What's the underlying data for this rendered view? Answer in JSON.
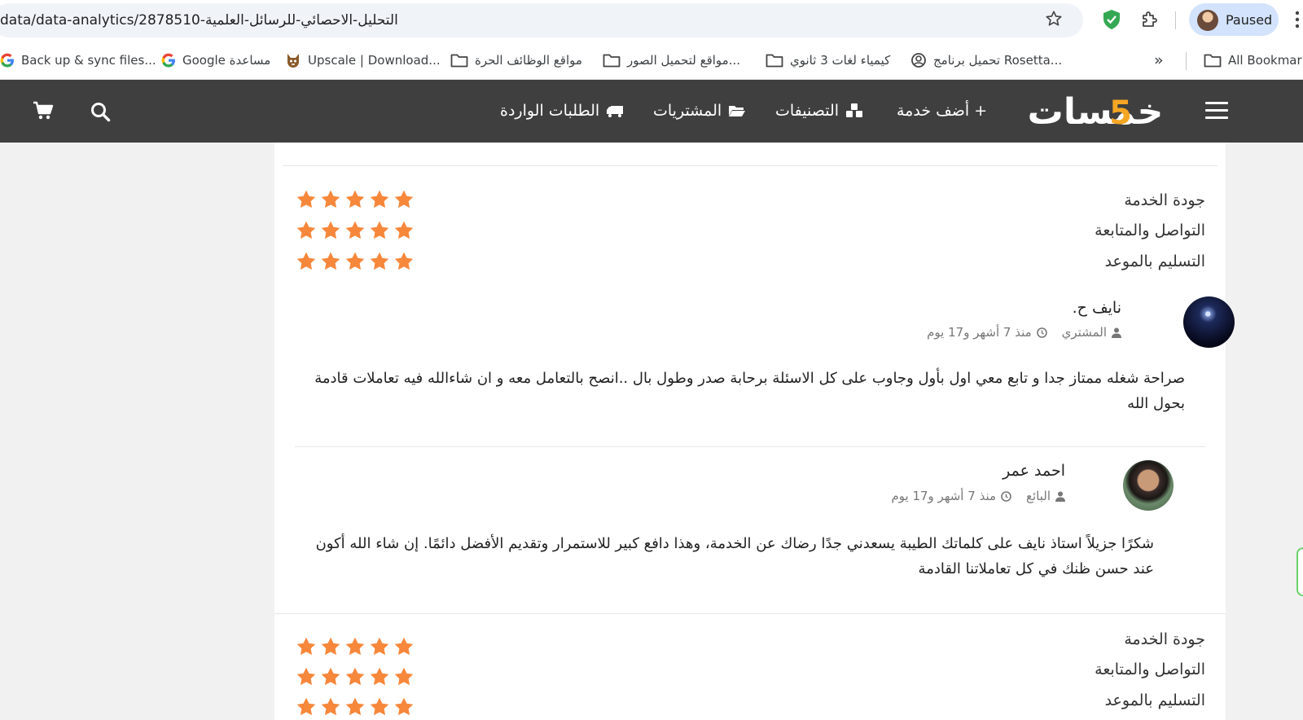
{
  "browser": {
    "url": "data/data-analytics/2878510-التحليل-الاحصائي-للرسائل-العلمية",
    "profile_label": "Paused",
    "bookmarks": [
      {
        "label": "Back up & sync files...",
        "icon": "google-icon"
      },
      {
        "label": "Google مساعدة",
        "icon": "google-icon"
      },
      {
        "label": "Upscale | Download...",
        "icon": "upscale-icon"
      },
      {
        "label": "مواقع الوظائف الحرة",
        "icon": "folder-icon"
      },
      {
        "label": "مواقع لتحميل الصور...",
        "icon": "folder-icon"
      },
      {
        "label": "كيمياء لغات 3 ثانوي",
        "icon": "folder-icon"
      },
      {
        "label": "تحميل برنامج Rosetta...",
        "icon": "rosetta-icon"
      }
    ],
    "bookmarks_overflow": "»",
    "all_bookmarks": "All Bookmarks"
  },
  "site": {
    "logo_text": "خمسات",
    "accent": "#f5a623",
    "header_bg": "#3f3f3f",
    "nav": [
      {
        "label": "+ أضف خدمة",
        "icon": "plus-icon"
      },
      {
        "label": "التصنيفات",
        "icon": "categories-icon"
      },
      {
        "label": "المشتريات",
        "icon": "folder-open-icon"
      },
      {
        "label": "الطلبات الواردة",
        "icon": "truck-icon"
      }
    ]
  },
  "ratings": {
    "quality": "جودة الخدمة",
    "communication": "التواصل والمتابعة",
    "delivery": "التسليم بالموعد",
    "first_block": {
      "quality": 5,
      "communication": 5,
      "delivery": 5
    },
    "second_block": {
      "quality": 5,
      "communication": 5,
      "delivery": 5
    },
    "star_color": "#f7873b"
  },
  "reviews": [
    {
      "name": "نايف ح.",
      "role": "المشتري",
      "time": "منذ 7 أشهر و17 يوم",
      "text": "صراحة شغله ممتاز جدا و تابع معي اول بأول وجاوب على كل الاسئلة برحابة صدر وطول بال ..انصح بالتعامل معه و ان شاءالله فيه تعاملات قادمة بحول الله"
    },
    {
      "name": "احمد عمر",
      "role": "البائع",
      "time": "منذ 7 أشهر و17 يوم",
      "text": "شكرًا جزيلاً استاذ نايف على كلماتك الطيبة يسعدني جدًا رضاك عن الخدمة، وهذا دافع كبير للاستمرار وتقديم الأفضل دائمًا. إن شاء الله أكون عند حسن ظنك في كل تعاملاتنا القادمة"
    }
  ]
}
